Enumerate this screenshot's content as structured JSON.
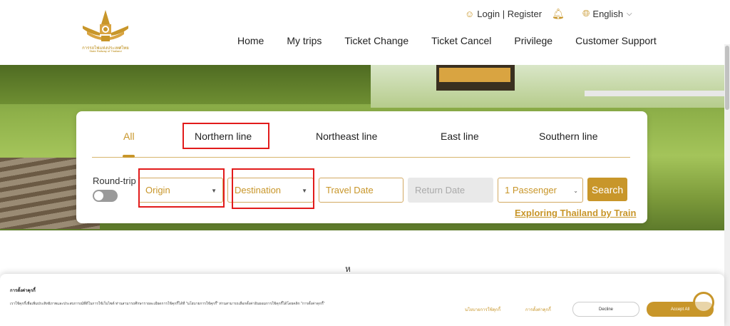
{
  "header": {
    "logo_text_line1": "การรถไฟแห่งประเทศไทย",
    "logo_text_line2": "State Railway of Thailand",
    "login_label": "Login | Register",
    "language": "English",
    "nav": [
      "Home",
      "My trips",
      "Ticket Change",
      "Ticket Cancel",
      "Privilege",
      "Customer Support"
    ]
  },
  "search": {
    "tabs": [
      "All",
      "Northern line",
      "Northeast line",
      "East line",
      "Southern line"
    ],
    "active_tab": "All",
    "roundtrip_label": "Round-trip",
    "roundtrip_on": false,
    "origin_placeholder": "Origin",
    "destination_placeholder": "Destination",
    "travel_date_placeholder": "Travel Date",
    "return_date_placeholder": "Return Date",
    "passenger_value": "1 Passenger",
    "search_button": "Search",
    "explore_link": "Exploring Thailand by Train"
  },
  "partial_heading": "ห",
  "cookie": {
    "title": "การตั้งค่าคุกกี้",
    "text": "เราใช้คุกกี้เพื่อเพิ่มประสิทธิภาพและประสบการณ์ที่ดีในการใช้เว็บไซต์ ท่านสามารถศึกษารายละเอียดการใช้คุกกี้ได้ที่ \"นโยบายการใช้คุกกี้\" ท่านสามารถเลือกตั้งค่าอินยอมการใช้คุกกี้ได้โดยคลิก \"การตั้งค่าคุกกี้\"",
    "policy_link": "นโยบายการใช้คุกกี้",
    "settings_link": "การตั้งค่าคุกกี้",
    "decline": "Decline",
    "accept": "Accept All"
  },
  "colors": {
    "accent": "#c8962a",
    "highlight_box": "#e21b1b"
  }
}
